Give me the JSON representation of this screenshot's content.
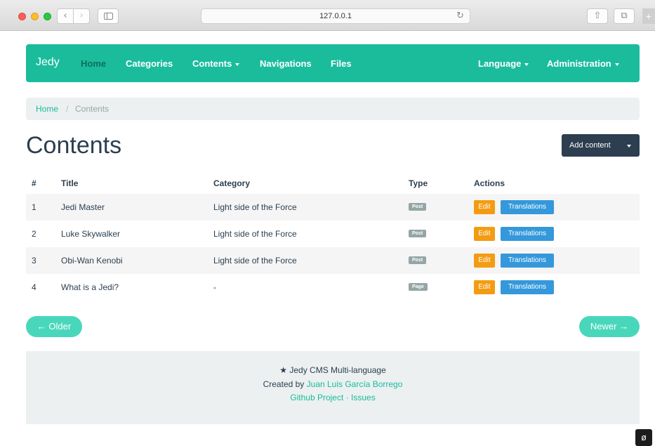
{
  "browser": {
    "url": "127.0.0.1",
    "back_icon": "chevron-left-icon",
    "forward_icon": "chevron-right-icon",
    "reload_icon": "reload-icon",
    "share_icon": "share-icon",
    "tabs_icon": "tabs-icon"
  },
  "navbar": {
    "brand": "Jedy",
    "items": [
      {
        "label": "Home",
        "active": true
      },
      {
        "label": "Categories",
        "active": false
      },
      {
        "label": "Contents",
        "active": false,
        "dropdown": true
      },
      {
        "label": "Navigations",
        "active": false
      },
      {
        "label": "Files",
        "active": false
      }
    ],
    "right_items": [
      {
        "label": "Language",
        "dropdown": true
      },
      {
        "label": "Administration",
        "dropdown": true
      }
    ],
    "color": "#1abc9c"
  },
  "breadcrumb": {
    "home": "Home",
    "separator": "/",
    "current": "Contents"
  },
  "page": {
    "title": "Contents",
    "add_button": "Add content"
  },
  "table": {
    "headers": [
      "#",
      "Title",
      "Category",
      "Type",
      "Actions"
    ],
    "rows": [
      {
        "num": "1",
        "title": "Jedi Master",
        "category": "Light side of the Force",
        "type": "Post",
        "edit": "Edit",
        "translations": "Translations"
      },
      {
        "num": "2",
        "title": "Luke Skywalker",
        "category": "Light side of the Force",
        "type": "Post",
        "edit": "Edit",
        "translations": "Translations"
      },
      {
        "num": "3",
        "title": "Obi-Wan Kenobi",
        "category": "Light side of the Force",
        "type": "Post",
        "edit": "Edit",
        "translations": "Translations"
      },
      {
        "num": "4",
        "title": "What is a Jedi?",
        "category": "-",
        "type": "Page",
        "edit": "Edit",
        "translations": "Translations"
      }
    ]
  },
  "pager": {
    "older": "← Older",
    "newer": "Newer →"
  },
  "footer": {
    "star_icon": "star-icon",
    "line1": "Jedy CMS Multi-language",
    "created_by": "Created by",
    "author": "Juan Luis García Borrego",
    "github": "Github Project",
    "dot": "·",
    "issues": "Issues"
  }
}
